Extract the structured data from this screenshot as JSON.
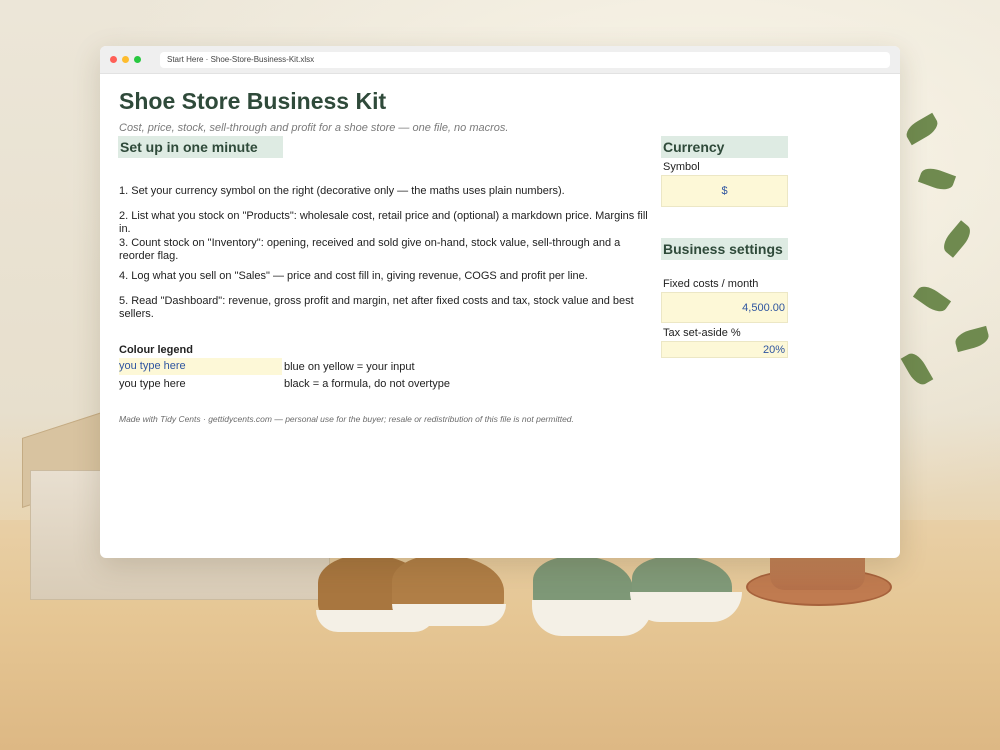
{
  "window": {
    "tab_title": "Start Here · Shoe-Store-Business-Kit.xlsx"
  },
  "sheet": {
    "title": "Shoe Store Business Kit",
    "subtitle": "Cost, price, stock, sell-through and profit for a shoe store — one file, no macros.",
    "setup_heading": "Set up in one minute",
    "steps": [
      "1. Set your currency symbol on the right (decorative only — the maths uses plain numbers).",
      "2. List what you stock on \"Products\": wholesale cost, retail price and (optional) a markdown price. Margins fill in.",
      "3. Count stock on \"Inventory\": opening, received and sold give on-hand, stock value, sell-through and a reorder flag.",
      "4. Log what you sell on \"Sales\" — price and cost fill in, giving revenue, COGS and profit per line.",
      "5. Read \"Dashboard\": revenue, gross profit and margin, net after fixed costs and tax, stock value and best sellers."
    ],
    "legend": {
      "title": "Colour legend",
      "input_sample": "you type here",
      "input_desc": "blue on yellow = your input",
      "formula_sample": "you type here",
      "formula_desc": "black = a formula, do not overtype"
    },
    "footer": "Made with Tidy Cents · gettidycents.com — personal use for the buyer; resale or redistribution of this file is not permitted."
  },
  "currency": {
    "heading": "Currency",
    "symbol_label": "Symbol",
    "symbol_value": "$"
  },
  "business": {
    "heading": "Business settings",
    "fixed_costs_label": "Fixed costs / month",
    "fixed_costs_value": "4,500.00",
    "tax_label": "Tax set-aside %",
    "tax_value": "20%"
  },
  "colors": {
    "heading_text": "#2f4a3a",
    "heading_fill": "#deebe3",
    "input_fill": "#fdf8d7",
    "input_text": "#2f55a0"
  }
}
